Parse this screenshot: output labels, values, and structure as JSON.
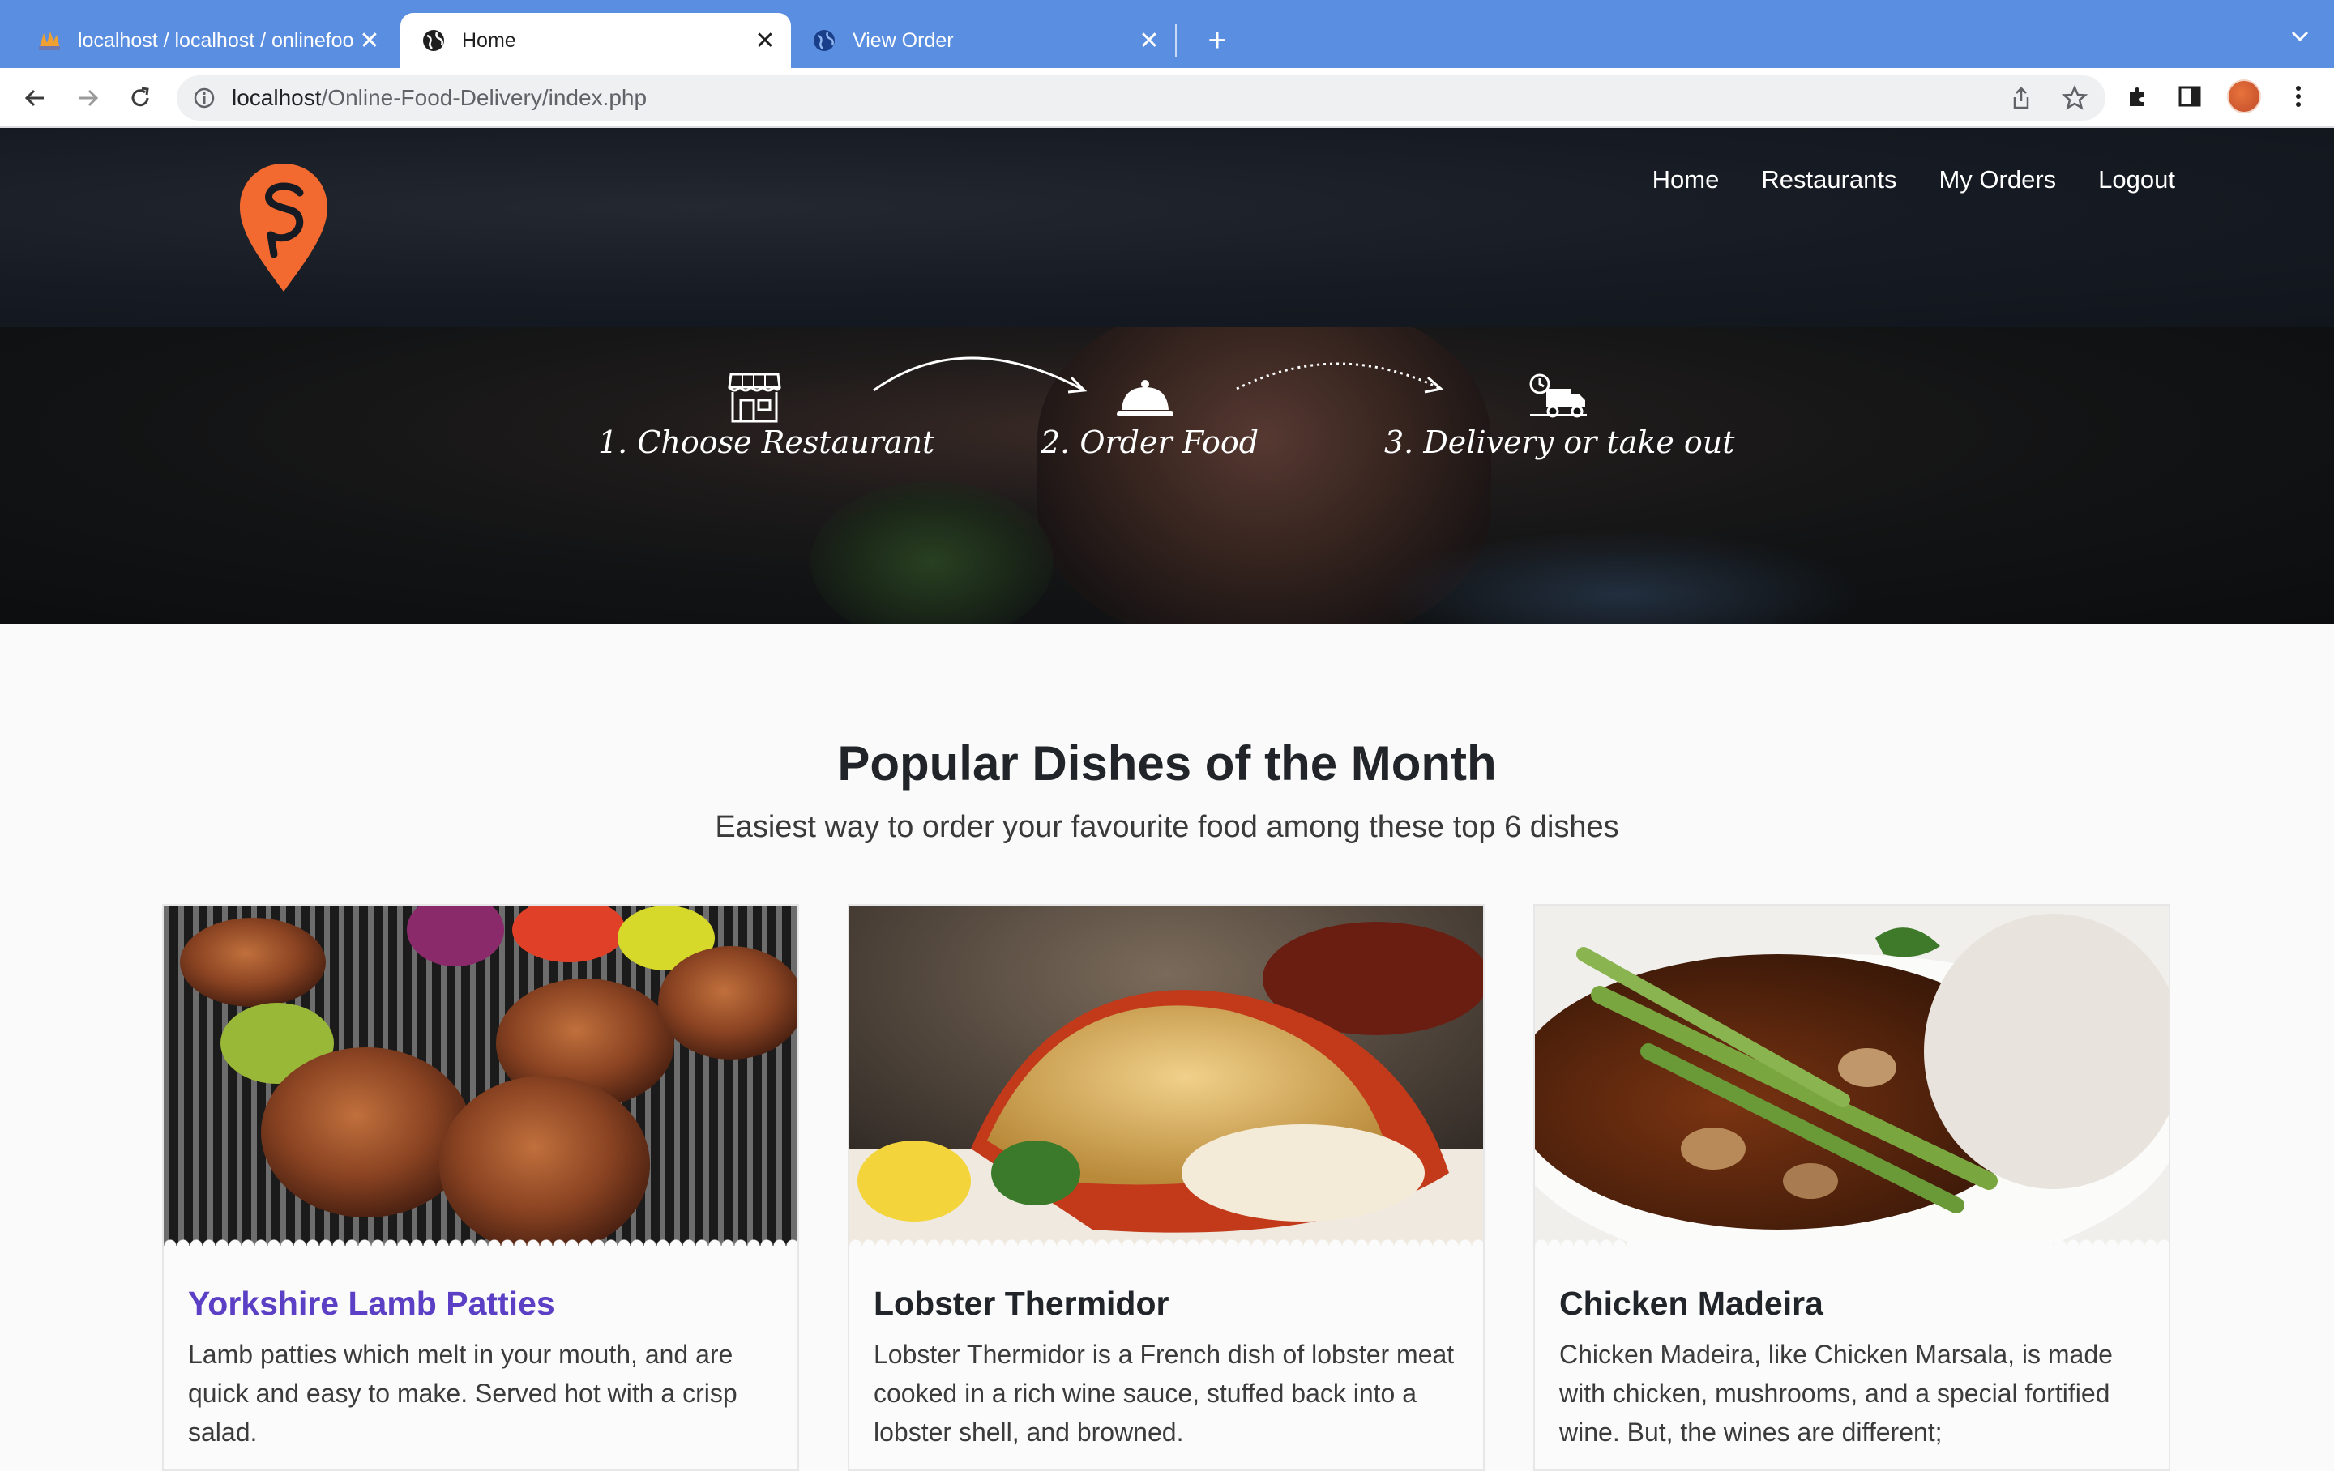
{
  "browser": {
    "tabs": [
      {
        "title": "localhost / localhost / onlinefoo",
        "active": false,
        "icon": "phpmyadmin-icon"
      },
      {
        "title": "Home",
        "active": true,
        "icon": "globe-icon"
      },
      {
        "title": "View Order",
        "active": false,
        "icon": "globe-icon"
      }
    ],
    "url_host": "localhost",
    "url_path": "/Online-Food-Delivery/index.php"
  },
  "site": {
    "nav": [
      {
        "label": "Home"
      },
      {
        "label": "Restaurants"
      },
      {
        "label": "My Orders"
      },
      {
        "label": "Logout"
      }
    ],
    "brand_color": "#f26a30"
  },
  "hero": {
    "steps": [
      {
        "label": "1. Choose Restaurant",
        "icon": "storefront-icon"
      },
      {
        "label": "2. Order Food",
        "icon": "food-cloche-icon"
      },
      {
        "label": "3. Delivery or take out",
        "icon": "delivery-truck-icon"
      }
    ]
  },
  "popular": {
    "title": "Popular Dishes of the Month",
    "subtitle": "Easiest way to order your favourite food among these top 6 dishes",
    "dishes": [
      {
        "name": "Yorkshire Lamb Patties",
        "description": "Lamb patties which melt in your mouth, and are quick and easy to make. Served hot with a crisp salad.",
        "hovered": true
      },
      {
        "name": "Lobster Thermidor",
        "description": "Lobster Thermidor is a French dish of lobster meat cooked in a rich wine sauce, stuffed back into a lobster shell, and browned.",
        "hovered": false
      },
      {
        "name": "Chicken Madeira",
        "description": "Chicken Madeira, like Chicken Marsala, is made with chicken, mushrooms, and a special fortified wine. But, the wines are different;",
        "hovered": false
      }
    ]
  }
}
